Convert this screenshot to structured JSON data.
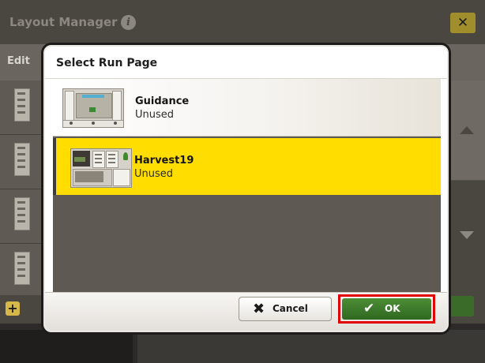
{
  "background_screen": {
    "title": "Layout Manager",
    "info_icon": "info-icon",
    "close_icon": "close-icon",
    "tab_label": "Edit",
    "add_icon": "plus-icon",
    "scroll_up_icon": "triangle-up-icon",
    "scroll_down_icon": "triangle-down-icon"
  },
  "modal": {
    "title": "Select Run Page",
    "run_pages": [
      {
        "name": "Guidance",
        "status": "Unused",
        "selected": false
      },
      {
        "name": "Harvest19",
        "status": "Unused",
        "selected": true
      }
    ],
    "cancel_label": "Cancel",
    "cancel_icon": "x-icon",
    "ok_label": "OK",
    "ok_icon": "checkmark-icon",
    "ok_highlighted": true
  },
  "colors": {
    "selected_row": "#ffdd00",
    "ok_button": "#3d7a2b",
    "highlight_box": "#e00000",
    "close_button": "#a08e2c"
  }
}
